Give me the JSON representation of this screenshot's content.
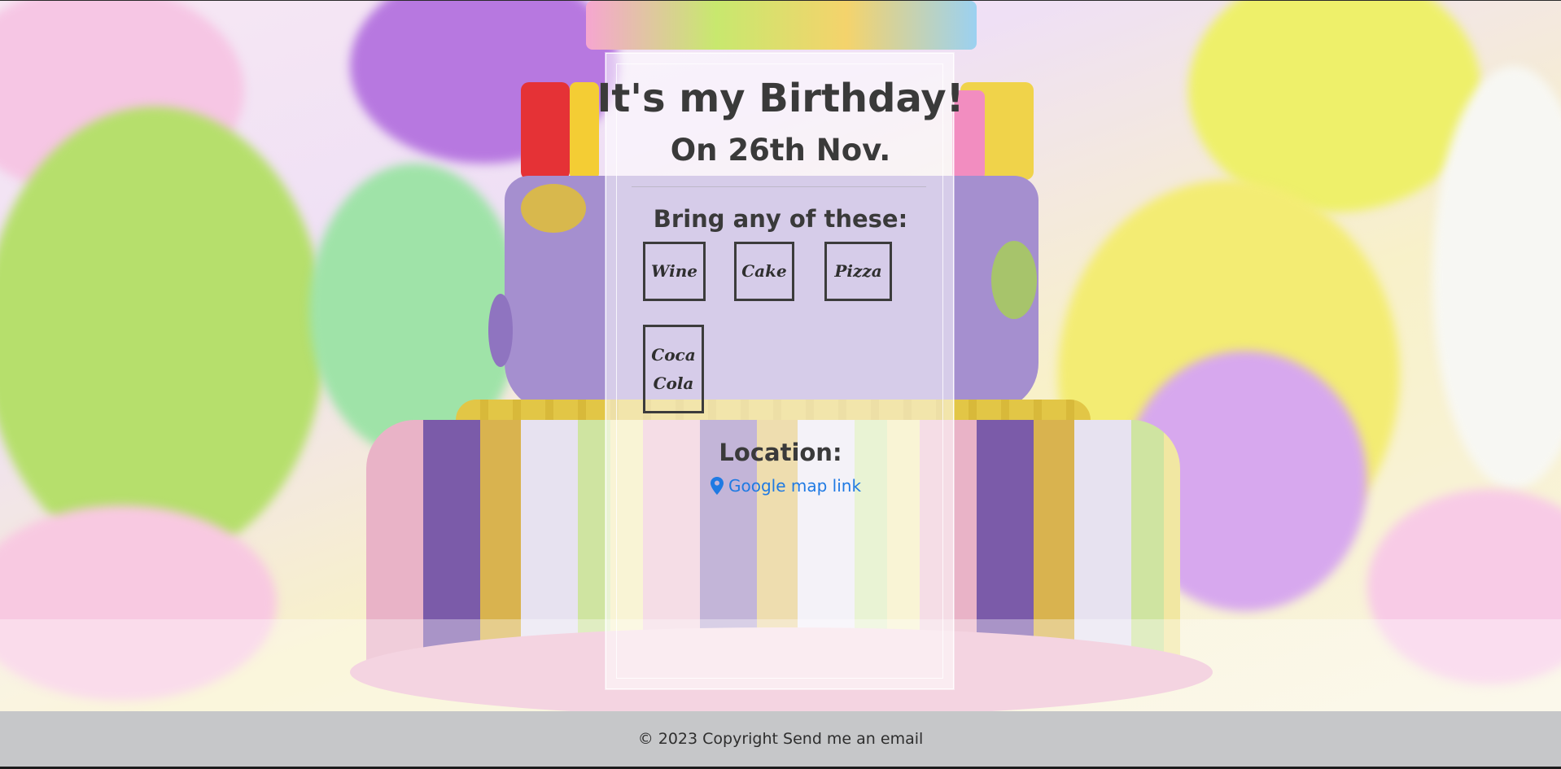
{
  "invitation": {
    "title": "It's my Birthday!",
    "date": "On 26th Nov.",
    "bring_heading": "Bring any of these:",
    "items": [
      {
        "label": "Wine"
      },
      {
        "label": "Cake"
      },
      {
        "label": "Pizza"
      },
      {
        "label": "Coca Cola"
      }
    ],
    "location_heading": "Location:",
    "map_link": "Google map link"
  },
  "footer": {
    "copyright": "© 2023 Copyright",
    "email_link": "Send me an email"
  },
  "icons": {
    "map_pin": "map-marker"
  },
  "colors": {
    "link": "#1f7ae3",
    "footer_bg": "#c6c7c9",
    "text": "#3a3a3a"
  }
}
